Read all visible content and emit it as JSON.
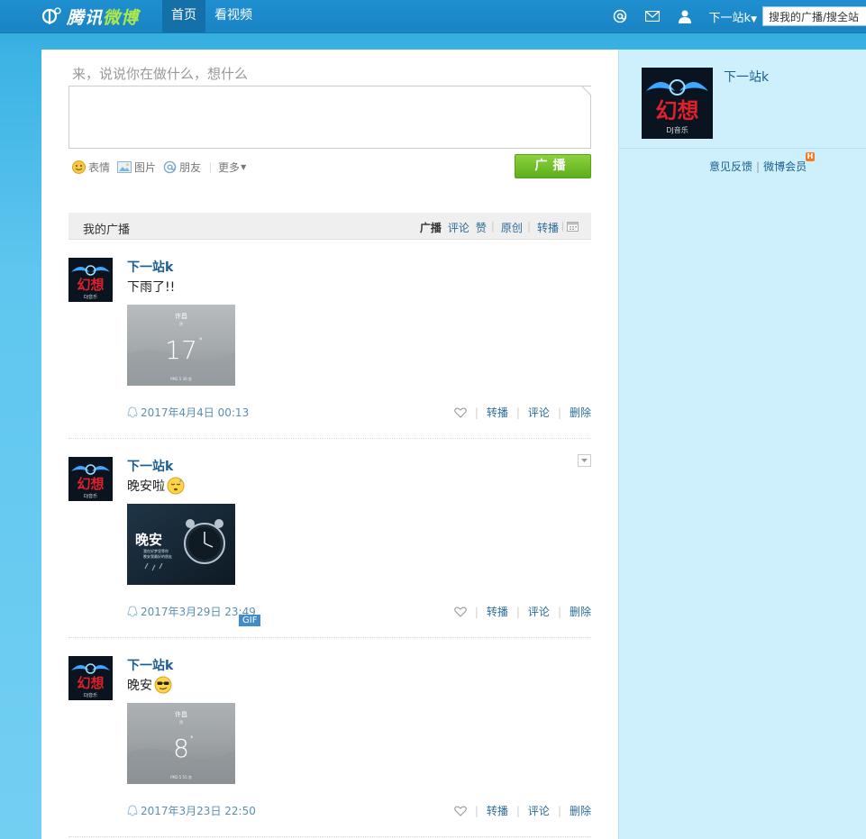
{
  "topbar": {
    "logo_text_a": "腾讯",
    "logo_text_b": "微博",
    "nav": [
      "首页",
      "看视频"
    ],
    "user_name": "下一站k",
    "search_placeholder": "搜我的广播/搜全站"
  },
  "compose": {
    "prompt": "来，说说你在做什么，想什么",
    "tools": {
      "emoji": "表情",
      "image": "图片",
      "friend": "朋友",
      "more": "更多"
    },
    "submit": "广播"
  },
  "feed": {
    "title": "我的广播",
    "filters": [
      "广播",
      "评论",
      "赞",
      "原创",
      "转播"
    ],
    "active_filter": "广播"
  },
  "posts": [
    {
      "author": "下一站k",
      "text": "下雨了!!",
      "emoji": "",
      "image": {
        "kind": "weather",
        "city": "许昌",
        "cond": "阴",
        "temp": "17",
        "deg": "°",
        "footer": "PM2.5 36 良"
      },
      "time": "2017年4月4日 00:13",
      "actions": [
        "转播",
        "评论",
        "删除"
      ]
    },
    {
      "author": "下一站k",
      "text": "晚安啦",
      "emoji": "sleepy-face",
      "image": {
        "kind": "goodnight",
        "headline": "晚安",
        "line1": "我在好梦里等你",
        "line2": "晚安我最好的朋友",
        "gif_label": "GIF"
      },
      "time": "2017年3月29日 23:49",
      "actions": [
        "转播",
        "评论",
        "删除"
      ]
    },
    {
      "author": "下一站k",
      "text": "晚安",
      "emoji": "cool-face",
      "image": {
        "kind": "weather",
        "city": "许昌",
        "cond": "阴",
        "temp": "8",
        "deg": "°",
        "footer": "PM2.5 55 良"
      },
      "time": "2017年3月23日 22:50",
      "actions": [
        "转播",
        "评论",
        "删除"
      ]
    }
  ],
  "sidebar": {
    "user_name": "下一站k",
    "links": [
      "意见反馈",
      "微博会员"
    ],
    "vip_badge": "H"
  },
  "avatar_text": {
    "main": "幻想",
    "sub": "DJ音乐"
  },
  "colors": {
    "accent_blue": "#1a84c4",
    "link_blue": "#2b6d99",
    "green_button": "#6cbf24",
    "sidebar_bg": "#cdf0fc"
  }
}
